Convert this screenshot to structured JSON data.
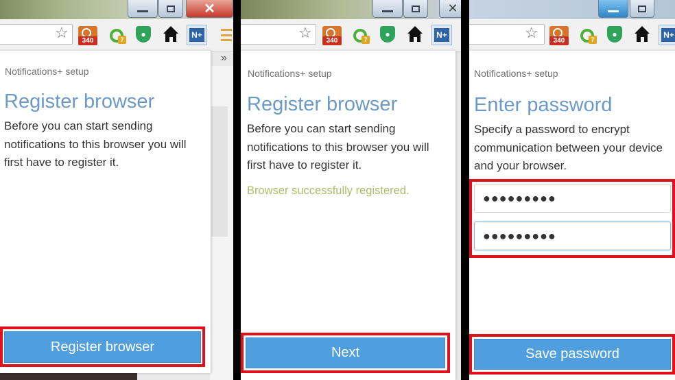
{
  "panels": [
    {
      "popup": {
        "header": "Notifications+ setup",
        "title": "Register browser",
        "body": "Before you can start sending notifications to this browser you will first have to register it.",
        "button": "Register browser"
      },
      "toolbar": {
        "badge_count": "340",
        "badge_small": "7",
        "ext_label": "N+",
        "chevron": "»"
      }
    },
    {
      "popup": {
        "header": "Notifications+ setup",
        "title": "Register browser",
        "body": "Before you can start sending notifications to this browser you will first have to register it.",
        "status": "Browser successfully registered.",
        "button": "Next"
      },
      "toolbar": {
        "badge_count": "340",
        "badge_small": "7",
        "ext_label": "N+"
      }
    },
    {
      "popup": {
        "header": "Notifications+ setup",
        "title": "Enter password",
        "body": "Specify a password to encrypt communication between your device and your browser.",
        "password": "●●●●●●●●●",
        "password_confirm": "●●●●●●●●●",
        "button": "Save password"
      },
      "toolbar": {
        "badge_count": "340",
        "badge_small": "7",
        "ext_label": "N+"
      }
    }
  ],
  "window_controls": {
    "minimize": "—",
    "close": "✕"
  },
  "icons": [
    "star-icon",
    "rss-badge-icon",
    "green-ring-icon",
    "shield-icon",
    "home-icon",
    "notifications-plus-icon",
    "menu-icon"
  ],
  "colors": {
    "accent_button": "#4f9fde",
    "title_blue": "#6b9ac7",
    "highlight_red": "#e0111c",
    "success_green": "#a9be6a"
  }
}
